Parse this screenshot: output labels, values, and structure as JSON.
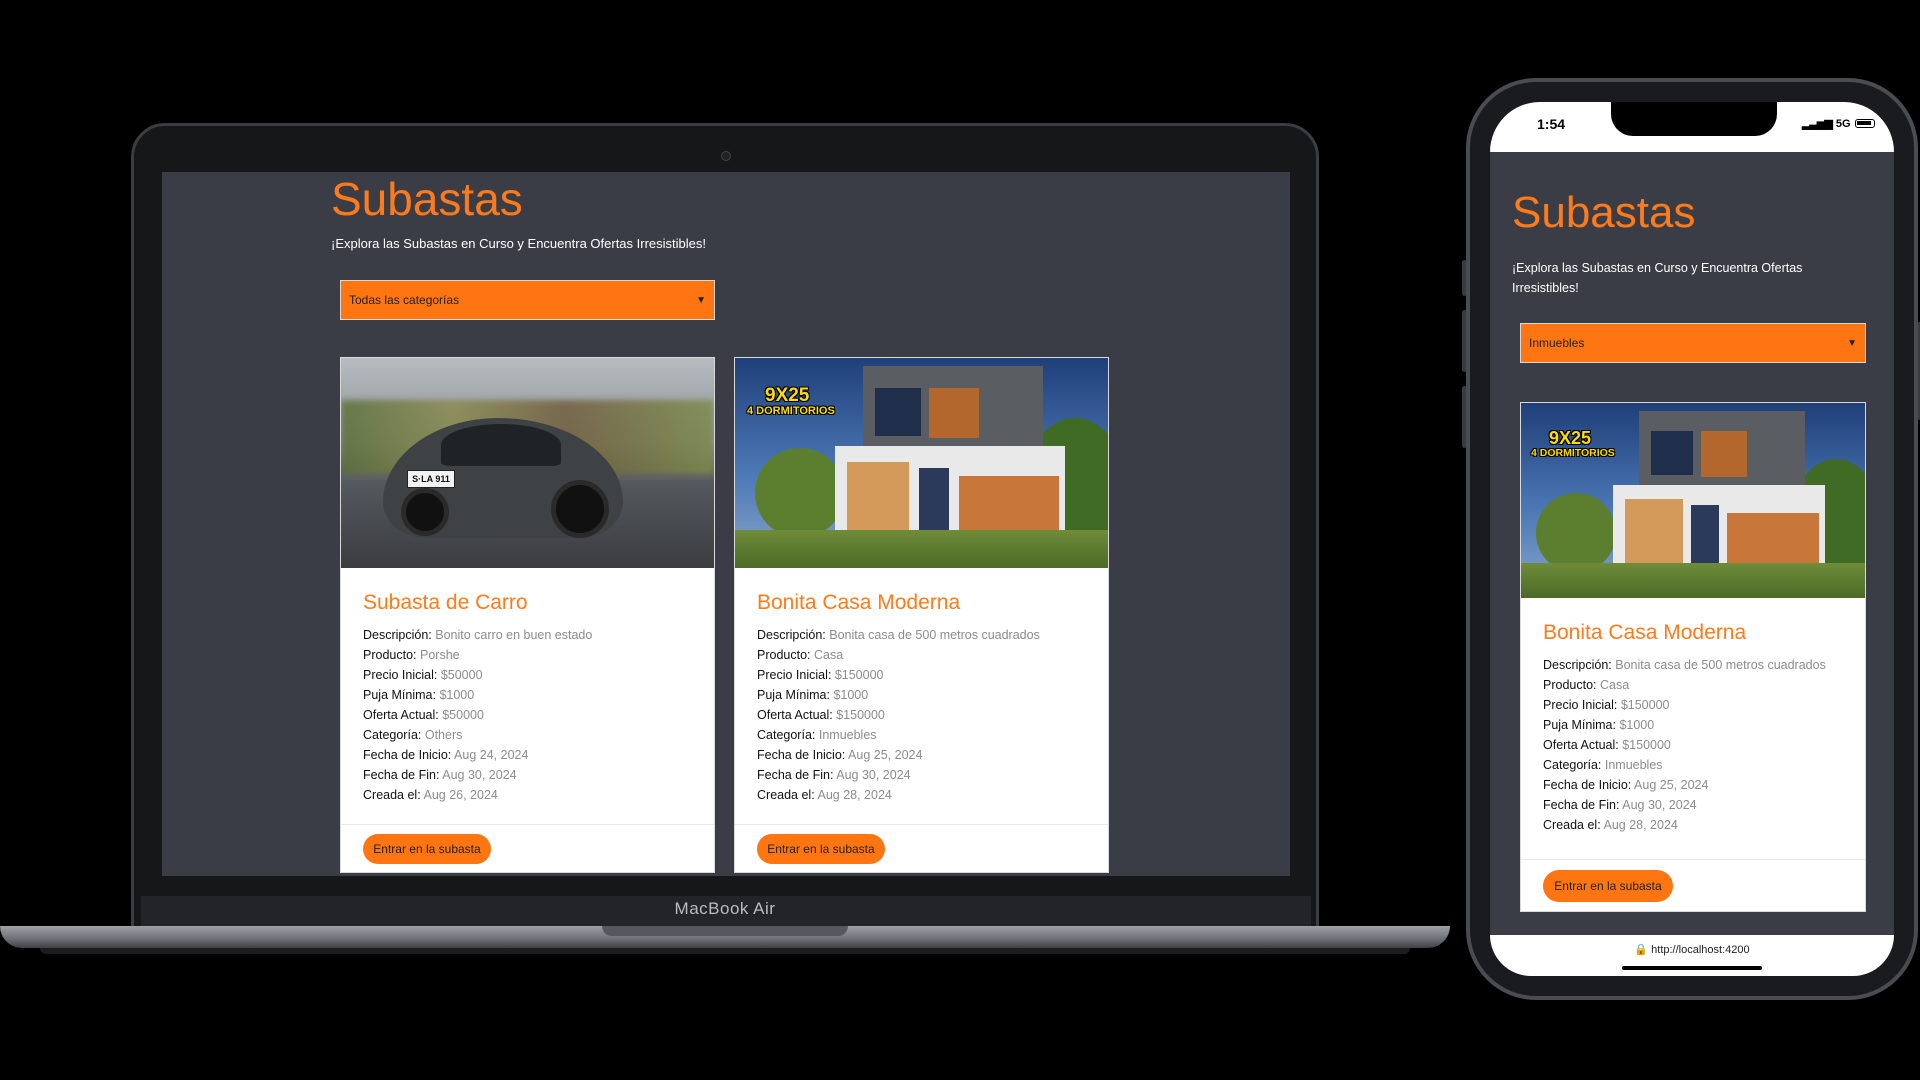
{
  "laptop": {
    "brand": "MacBook Air"
  },
  "phone": {
    "time": "1:54",
    "network": "5G",
    "url": "http://localhost:4200"
  },
  "app": {
    "title": "Subastas",
    "tagline": "¡Explora las Subastas en Curso y Encuentra Ofertas Irresistibles!",
    "filter_laptop": "Todas las categorías",
    "filter_phone": "Inmuebles",
    "labels": {
      "descripcion": "Descripción:",
      "producto": "Producto:",
      "precio_inicial": "Precio Inicial:",
      "puja_minima": "Puja Mínima:",
      "oferta_actual": "Oferta Actual:",
      "categoria": "Categoría:",
      "fecha_inicio": "Fecha de Inicio:",
      "fecha_fin": "Fecha de Fin:",
      "creada": "Creada el:"
    },
    "enter_button": "Entrar en la subasta",
    "auctions": [
      {
        "title": "Subasta de Carro",
        "descripcion": "Bonito carro en buen estado",
        "producto": "Porshe",
        "precio_inicial": "$50000",
        "puja_minima": "$1000",
        "oferta_actual": "$50000",
        "categoria": "Others",
        "fecha_inicio": "Aug 24, 2024",
        "fecha_fin": "Aug 30, 2024",
        "creada": "Aug 26, 2024",
        "image_plate": "S·LA 911"
      },
      {
        "title": "Bonita Casa Moderna",
        "descripcion": "Bonita casa de 500 metros cuadrados",
        "producto": "Casa",
        "precio_inicial": "$150000",
        "puja_minima": "$1000",
        "oferta_actual": "$150000",
        "categoria": "Inmuebles",
        "fecha_inicio": "Aug 25, 2024",
        "fecha_fin": "Aug 30, 2024",
        "creada": "Aug 28, 2024",
        "image_label_1": "9X25",
        "image_label_2": "4 DORMITORIOS"
      }
    ]
  }
}
